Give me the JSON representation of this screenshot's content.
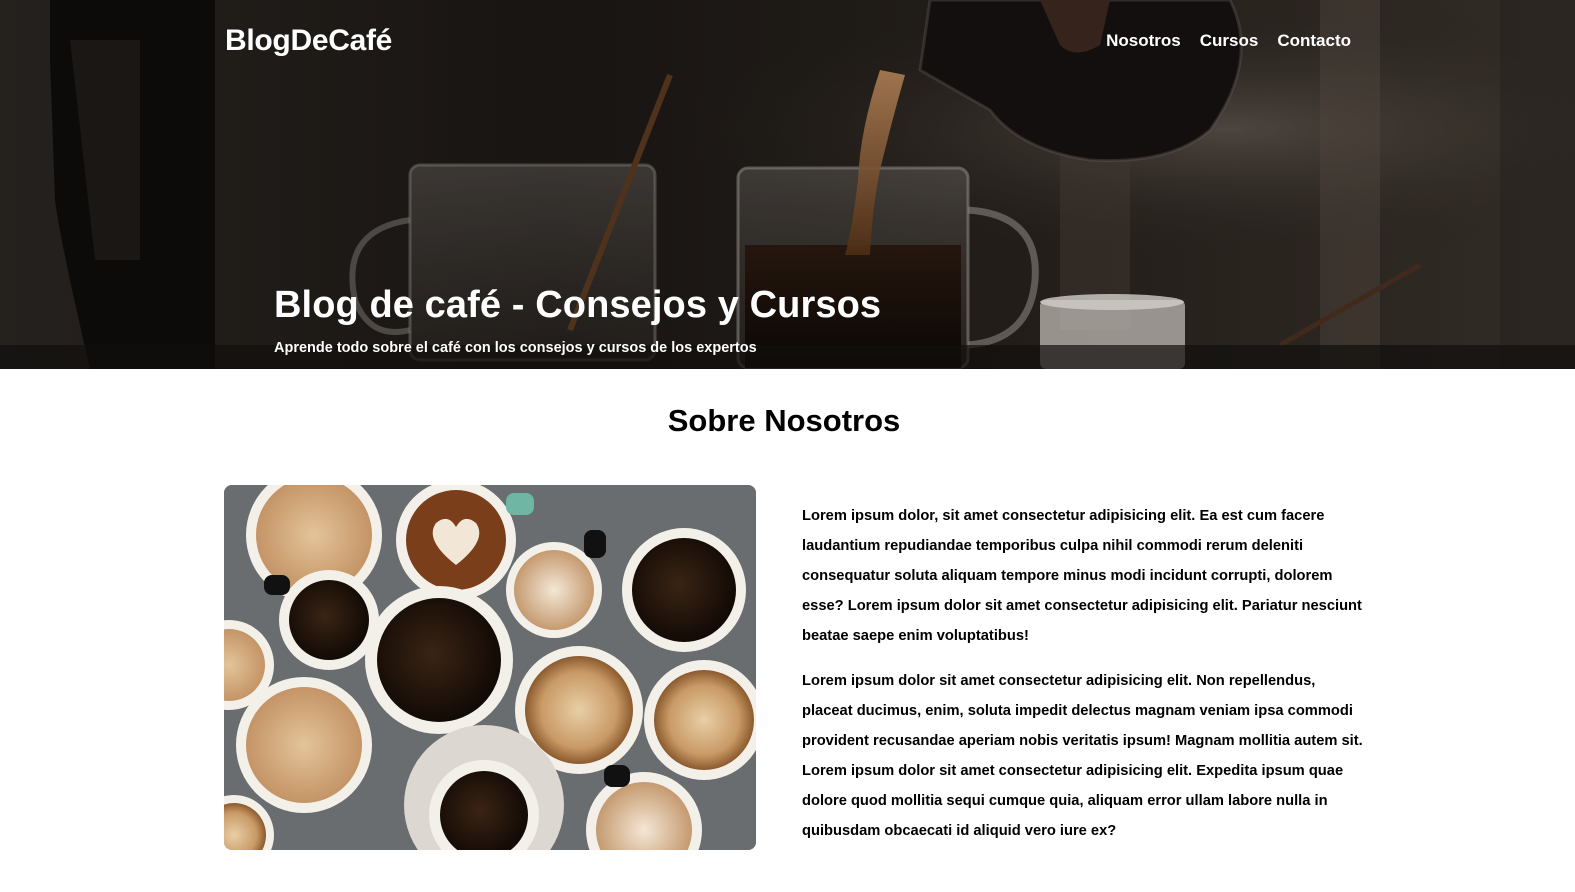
{
  "brand": {
    "name": "BlogDeCafé"
  },
  "nav": {
    "items": [
      {
        "label": "Nosotros"
      },
      {
        "label": "Cursos"
      },
      {
        "label": "Contacto"
      }
    ]
  },
  "hero": {
    "title": "Blog de café - Consejos y Cursos",
    "subtitle": "Aprende todo sobre el café con los consejos y cursos de los expertos",
    "image": "coffee-pouring-photo"
  },
  "about": {
    "title": "Sobre Nosotros",
    "image": "coffee-cups-photo",
    "paragraphs": [
      "Lorem ipsum dolor, sit amet consectetur adipisicing elit. Ea est cum facere laudantium repudiandae temporibus culpa nihil commodi rerum deleniti consequatur soluta aliquam tempore minus modi incidunt corrupti, dolorem esse? Lorem ipsum dolor sit amet consectetur adipisicing elit. Pariatur nesciunt beatae saepe enim voluptatibus!",
      "Lorem ipsum dolor sit amet consectetur adipisicing elit. Non repellendus, placeat ducimus, enim, soluta impedit delectus magnam veniam ipsa commodi provident recusandae aperiam nobis veritatis ipsum! Magnam mollitia autem sit. Lorem ipsum dolor sit amet consectetur adipisicing elit. Expedita ipsum quae dolore quod mollitia sequi cumque quia, aliquam error ullam labore nulla in quibusdam obcaecati id aliquid vero iure ex?"
    ]
  },
  "colors": {
    "text": "#000000",
    "hero_text": "#ffffff",
    "background": "#ffffff"
  }
}
